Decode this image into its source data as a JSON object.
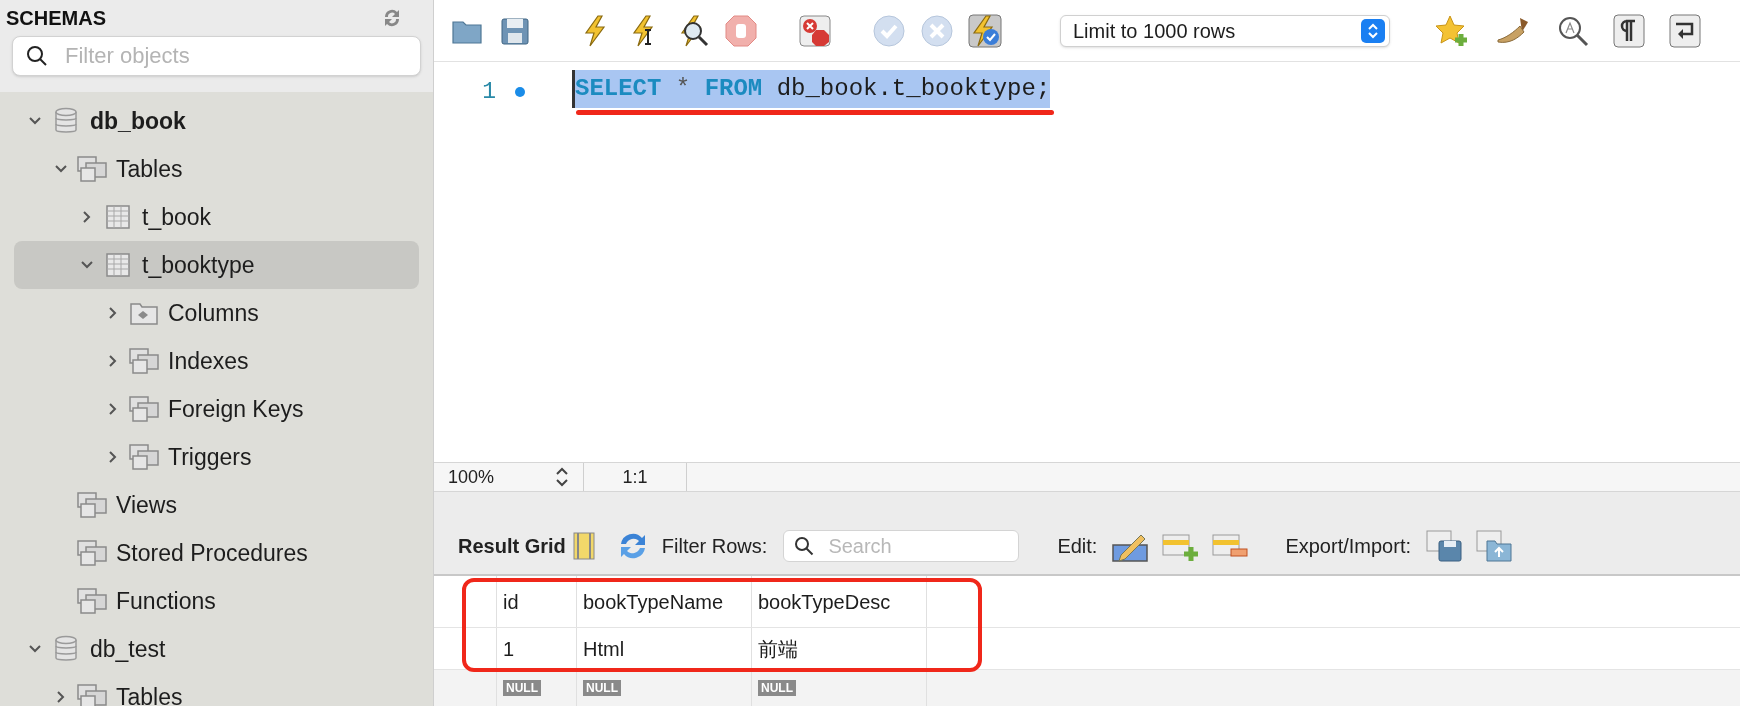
{
  "sidebar": {
    "title": "SCHEMAS",
    "filter": {
      "placeholder": "Filter objects"
    },
    "tree": [
      {
        "label": "db_book",
        "kind": "database",
        "default": true,
        "expanded": true,
        "selected": false,
        "children": [
          {
            "label": "Tables",
            "kind": "group",
            "expanded": true,
            "selected": false,
            "children": [
              {
                "label": "t_book",
                "kind": "table",
                "expanded": false,
                "selected": false
              },
              {
                "label": "t_booktype",
                "kind": "table",
                "expanded": true,
                "selected": true,
                "children": [
                  {
                    "label": "Columns",
                    "kind": "columns",
                    "expanded": false,
                    "selected": false
                  },
                  {
                    "label": "Indexes",
                    "kind": "group",
                    "expanded": false,
                    "selected": false
                  },
                  {
                    "label": "Foreign Keys",
                    "kind": "group",
                    "expanded": false,
                    "selected": false
                  },
                  {
                    "label": "Triggers",
                    "kind": "group",
                    "expanded": false,
                    "selected": false
                  }
                ]
              }
            ]
          },
          {
            "label": "Views",
            "kind": "group",
            "selected": false
          },
          {
            "label": "Stored Procedures",
            "kind": "group",
            "selected": false
          },
          {
            "label": "Functions",
            "kind": "group",
            "selected": false
          }
        ]
      },
      {
        "label": "db_test",
        "kind": "database",
        "default": false,
        "expanded": true,
        "selected": false,
        "children": [
          {
            "label": "Tables",
            "kind": "group",
            "expanded": false,
            "selected": false
          }
        ]
      }
    ]
  },
  "toolbar": {
    "limit_select": "Limit to 1000 rows"
  },
  "editor": {
    "line_number": "1",
    "selected": true,
    "tokens": [
      {
        "text": "SELECT",
        "kind": "keyword"
      },
      {
        "text": " * ",
        "kind": "operator"
      },
      {
        "text": "FROM",
        "kind": "keyword"
      },
      {
        "text": " db_book.t_booktype;",
        "kind": "plain"
      }
    ]
  },
  "status_bar": {
    "zoom": "100%",
    "position": "1:1"
  },
  "result": {
    "title": "Result Grid",
    "filter_label": "Filter Rows:",
    "search": {
      "placeholder": "Search"
    },
    "edit_label": "Edit:",
    "export_label": "Export/Import:",
    "columns": [
      "id",
      "bookTypeName",
      "bookTypeDesc"
    ],
    "rows": [
      [
        "1",
        "Html",
        "前端"
      ]
    ],
    "null_row": [
      "NULL",
      "NULL",
      "NULL"
    ]
  }
}
